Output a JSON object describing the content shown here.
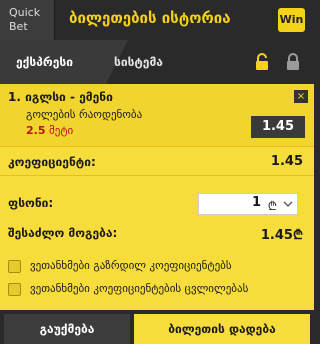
{
  "header": {
    "quick_bet_line1": "Quick",
    "quick_bet_line2": "Bet",
    "title": "ბილეთების ისტორია",
    "win_badge": "Win"
  },
  "tabs": {
    "express": "ექსპრესი",
    "system": "სისტემა",
    "unlock_icon": "unlock-icon",
    "lock_icon": "lock-icon"
  },
  "selection": {
    "index": "1.",
    "match": "იგლსი - ემენი",
    "market": "გოლების რაოდენობა",
    "line_value": "2.5",
    "line_label": "მეტი",
    "odds": "1.45",
    "remove_label": "×"
  },
  "coefficient": {
    "label": "კოეფიციენტი:",
    "value": "1.45"
  },
  "stake": {
    "label": "ფსონი:",
    "value": "1",
    "currency": "₾"
  },
  "possible_win": {
    "label": "შესაძლო მოგება:",
    "value": "1.45₾"
  },
  "options": [
    {
      "label": "ვეთანხმები გაზრდილ კოეფიციენტებს",
      "checked": false
    },
    {
      "label": "ვეთანხმები კოეფიციენტების ცვლილებას",
      "checked": false
    }
  ],
  "footer": {
    "clear": "გაუქმება",
    "place": "ბილეთის დადება"
  },
  "colors": {
    "accent_yellow": "#f7dd3c",
    "dark": "#2a2a2a",
    "odds_red": "#b8141f"
  }
}
